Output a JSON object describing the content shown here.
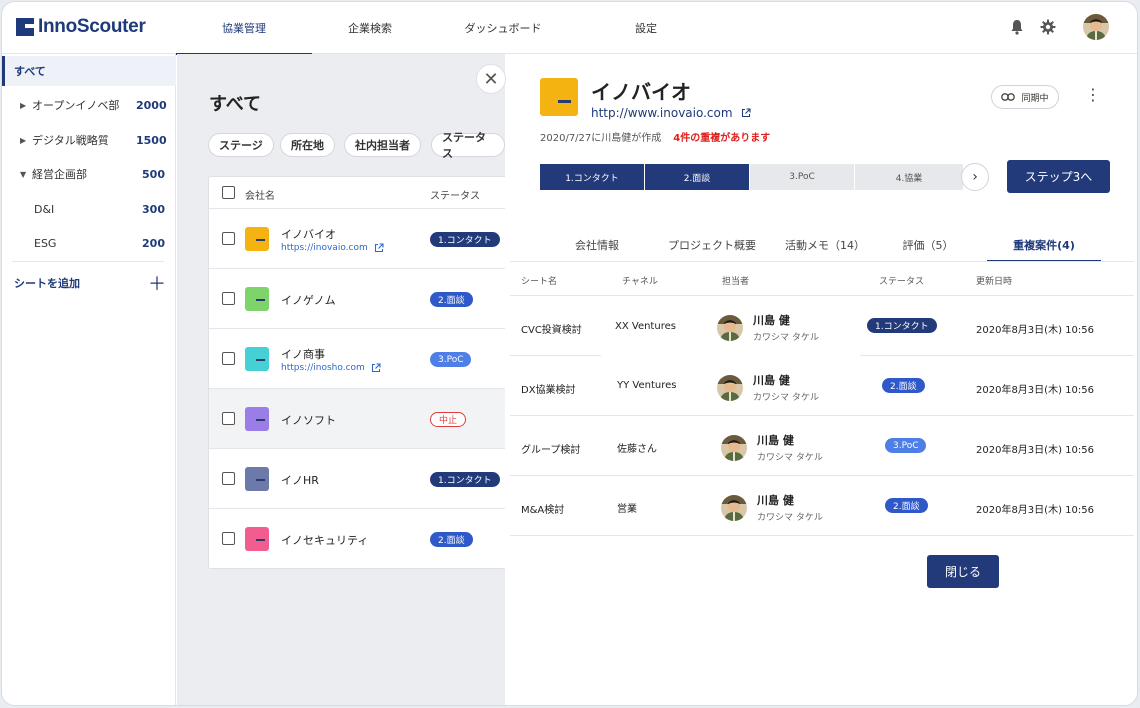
{
  "app": {
    "logo_text": "InnoScouter"
  },
  "nav": {
    "tabs": [
      {
        "label": "協業管理",
        "active": true
      },
      {
        "label": "企業検索"
      },
      {
        "label": "ダッシュボード"
      },
      {
        "label": "設定"
      }
    ],
    "icons": [
      "bell-icon",
      "gear-icon",
      "avatar"
    ]
  },
  "sidebar": {
    "all_label": "すべて",
    "items": [
      {
        "label": "オープンイノベ部",
        "count": "2000",
        "caret": "▶"
      },
      {
        "label": "デジタル戦略質",
        "count": "1500",
        "caret": "▶"
      },
      {
        "label": "経営企画部",
        "count": "500",
        "caret": "▼"
      },
      {
        "label": "D&I",
        "count": "300",
        "caret": ""
      },
      {
        "label": "ESG",
        "count": "200",
        "caret": ""
      }
    ],
    "add_label": "シートを追加",
    "add_icon": "＋"
  },
  "list": {
    "title": "すべて",
    "filters": [
      "ステージ",
      "所在地",
      "社内担当者",
      "ステータス"
    ],
    "col_company": "会社名",
    "col_status": "ステータス",
    "rows": [
      {
        "name": "イノバイオ",
        "url": "https://inovaio.com",
        "status": "1.コンタクト",
        "logo_color": "#f5b311"
      },
      {
        "name": "イノゲノム",
        "url": "",
        "status": "2.面談",
        "logo_color": "#7fd36b"
      },
      {
        "name": "イノ商事",
        "url": "https://inosho.com",
        "status": "3.PoC",
        "logo_color": "#45d0d6"
      },
      {
        "name": "イノソフト",
        "url": "",
        "status": "中止",
        "logo_color": "#9a7de6"
      },
      {
        "name": "イノHR",
        "url": "",
        "status": "1.コンタクト",
        "logo_color": "#6b7aa8"
      },
      {
        "name": "イノセキュリティ",
        "url": "",
        "status": "2.面談",
        "logo_color": "#f25c8e"
      }
    ]
  },
  "close_icon": "✕",
  "detail": {
    "name": "イノバイオ",
    "url": "http://www.inovaio.com",
    "created": "2020/7/27に川島健が作成",
    "duplicate_warning": "4件の重複があります",
    "sync_label": "同期中",
    "kebab": "⋮",
    "steps": [
      {
        "label": "1.コンタクト",
        "done": true
      },
      {
        "label": "2.面談",
        "done": true
      },
      {
        "label": "3.PoC",
        "done": false
      },
      {
        "label": "4.協業",
        "done": false
      }
    ],
    "step_next_icon": "›",
    "step_button": "ステップ3へ",
    "tabs": [
      "会社情報",
      "プロジェクト概要",
      "活動メモ（14）",
      "評価（5）",
      "重複案件(4)"
    ],
    "table": {
      "headers": [
        "シート名",
        "チャネル",
        "担当者",
        "ステータス",
        "更新日時"
      ],
      "rows": [
        {
          "sheet": "CVC投資検討",
          "channel": "XX Ventures",
          "person": "川島 健",
          "kana": "カワシマ タケル",
          "status": "1.コンタクト",
          "updated": "2020年8月3日(木) 10:56"
        },
        {
          "sheet": "DX協業検討",
          "channel": "YY Ventures",
          "person": "川島 健",
          "kana": "カワシマ タケル",
          "status": "2.面談",
          "updated": "2020年8月3日(木) 10:56"
        },
        {
          "sheet": "グループ検討",
          "channel": "佐藤さん",
          "person": "川島 健",
          "kana": "カワシマ タケル",
          "status": "3.PoC",
          "updated": "2020年8月3日(木) 10:56"
        },
        {
          "sheet": "M&A検討",
          "channel": "営業",
          "person": "川島 健",
          "kana": "カワシマ タケル",
          "status": "2.面談",
          "updated": "2020年8月3日(木) 10:56"
        }
      ]
    },
    "close_button": "閉じる"
  }
}
